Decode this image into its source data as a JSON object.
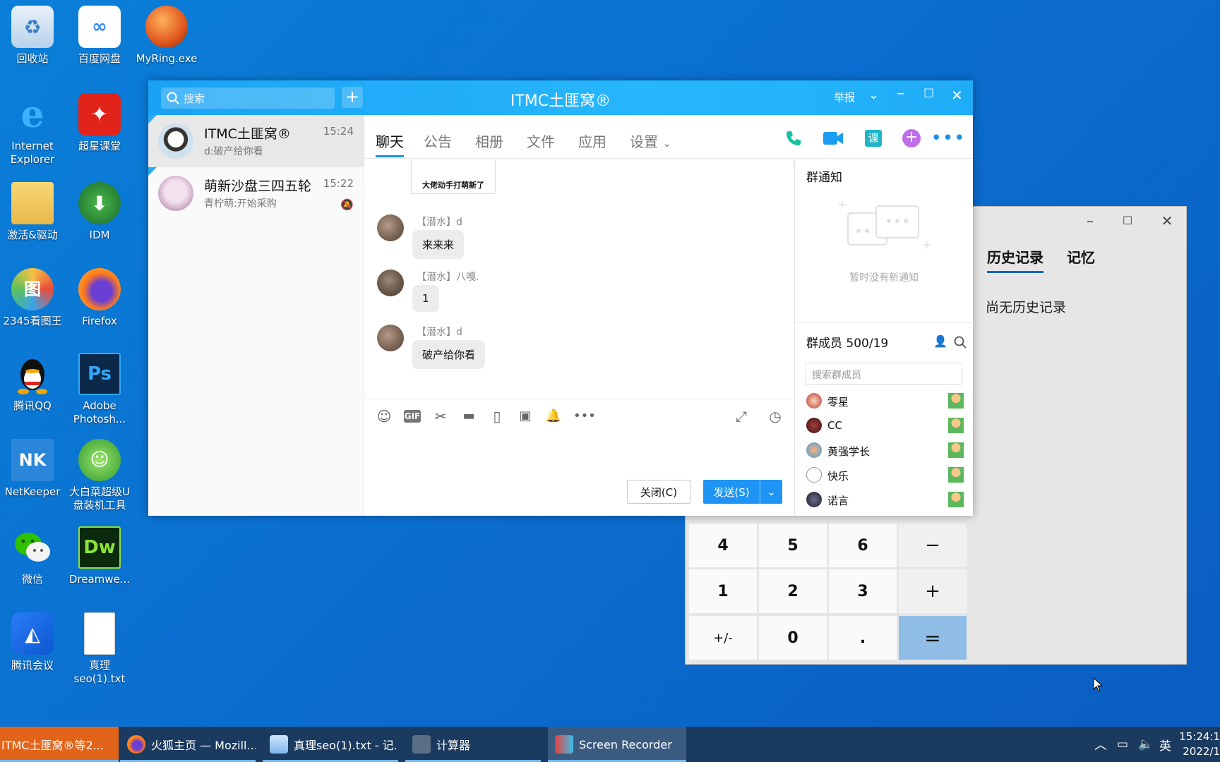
{
  "desktop": {
    "icons": [
      {
        "label": "回收站",
        "icon": "recycle-bin-icon"
      },
      {
        "label": "百度网盘",
        "icon": "baidu-netdisk-icon"
      },
      {
        "label": "MyRing.exe",
        "icon": "myring-icon"
      },
      {
        "label": "Internet Explorer",
        "icon": "ie-icon"
      },
      {
        "label": "超星课堂",
        "icon": "chaoxing-icon"
      },
      {
        "label": "激活&驱动",
        "icon": "folder-icon"
      },
      {
        "label": "IDM",
        "icon": "idm-icon"
      },
      {
        "label": "2345看图王",
        "icon": "viewer-icon"
      },
      {
        "label": "Firefox",
        "icon": "firefox-icon"
      },
      {
        "label": "腾讯QQ",
        "icon": "qq-icon"
      },
      {
        "label": "Adobe Photosh...",
        "icon": "photoshop-icon"
      },
      {
        "label": "NetKeeper",
        "icon": "netkeeper-icon"
      },
      {
        "label": "大白菜超级U盘装机工具",
        "icon": "dabaicai-icon"
      },
      {
        "label": "微信",
        "icon": "wechat-icon"
      },
      {
        "label": "Dreamwe...",
        "icon": "dreamweaver-icon"
      },
      {
        "label": "腾讯会议",
        "icon": "tencent-meeting-icon"
      },
      {
        "label": "真理seo(1).txt",
        "icon": "text-file-icon"
      }
    ]
  },
  "calculator": {
    "tabs": [
      "历史记录",
      "记忆"
    ],
    "history_empty": "尚无历史记录",
    "keys": [
      "4",
      "5",
      "6",
      "−",
      "1",
      "2",
      "3",
      "+",
      "+/-",
      "0",
      ".",
      "="
    ]
  },
  "qq": {
    "search_placeholder": "搜索",
    "plus": "+",
    "title": "ITMC土匪窝®",
    "report": "举报",
    "sessions": [
      {
        "name": "ITMC土匪窝®",
        "preview": "d:破产给你看",
        "time": "15:24"
      },
      {
        "name": "萌新沙盘三四五轮",
        "preview": "青柠萌:开始采购",
        "time": "15:22"
      }
    ],
    "tabs": [
      "聊天",
      "公告",
      "相册",
      "文件",
      "应用",
      "设置"
    ],
    "sticker_caption": "大佬动手打萌新了",
    "messages": [
      {
        "sender": "【潜水】d",
        "text": "来来来"
      },
      {
        "sender": "【潜水】八嘎.",
        "text": "1"
      },
      {
        "sender": "【潜水】d",
        "text": "破产给你看"
      }
    ],
    "close_btn": "关闭(C)",
    "send_btn": "发送(S)",
    "notice_title": "群通知",
    "notice_empty": "暂时没有新通知",
    "members_title": "群成员 500/19",
    "member_search_placeholder": "搜索群成员",
    "members": [
      "零星",
      "CC",
      "黄强学长",
      "快乐",
      "诺言"
    ]
  },
  "taskbar": {
    "items": [
      {
        "label": "ITMC土匪窝®等2...",
        "icon": "qq-task-icon"
      },
      {
        "label": "火狐主页 — Mozill...",
        "icon": "firefox-task-icon"
      },
      {
        "label": "真理seo(1).txt - 记...",
        "icon": "notepad-task-icon"
      },
      {
        "label": "计算器",
        "icon": "calculator-task-icon"
      },
      {
        "label": "Screen Recorder",
        "icon": "screen-recorder-task-icon"
      }
    ],
    "ime": "英",
    "time": "15:24:1",
    "date": "2022/1"
  }
}
